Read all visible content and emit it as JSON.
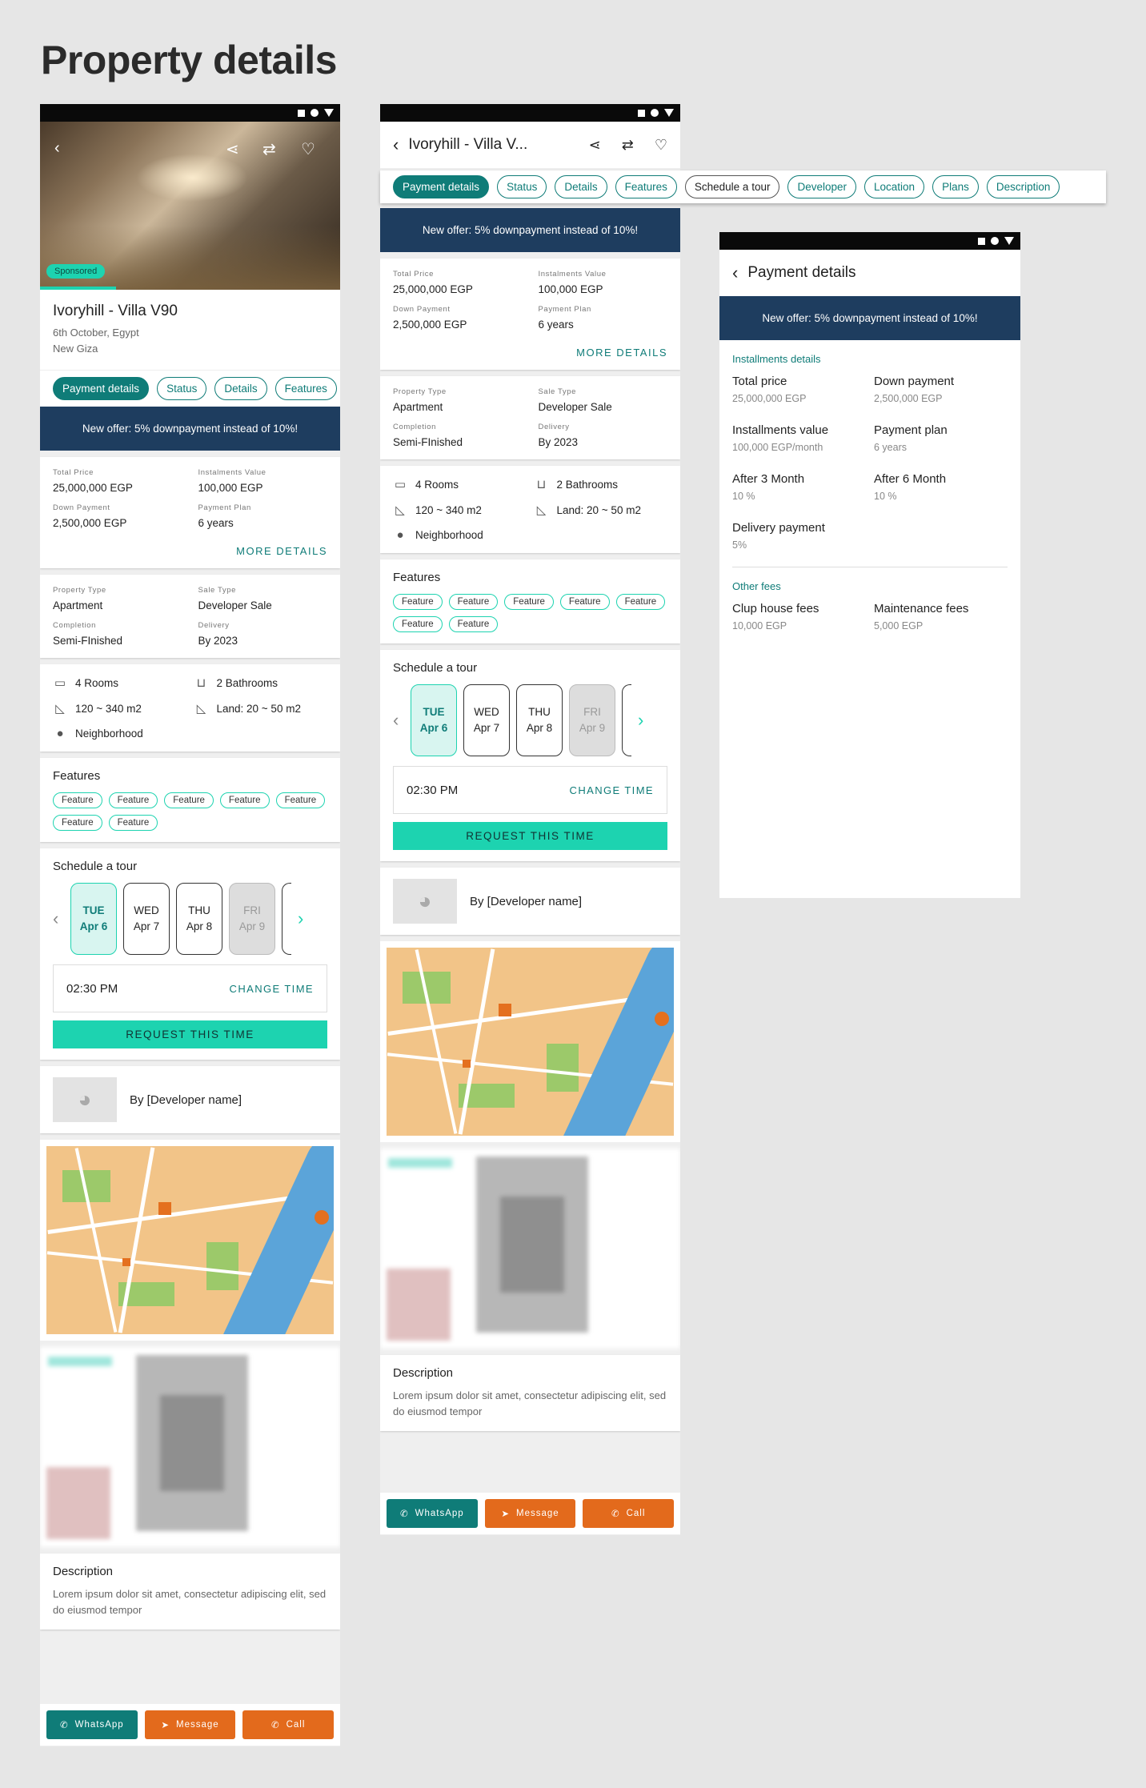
{
  "page_title": "Property details",
  "property": {
    "name": "Ivoryhill - Villa V90",
    "name_short": "Ivoryhill - Villa V...",
    "city": "6th October, Egypt",
    "area": "New Giza",
    "sponsored": "Sponsored"
  },
  "tabs": [
    "Payment details",
    "Status",
    "Details",
    "Features",
    "Schedule a tour",
    "Developer",
    "Location",
    "Plans",
    "Description"
  ],
  "offer": "New offer: 5% downpayment instead of 10%!",
  "price": {
    "total_label": "Total Price",
    "total": "25,000,000 EGP",
    "inst_label": "Instalments Value",
    "inst": "100,000 EGP",
    "down_label": "Down Payment",
    "down": "2,500,000 EGP",
    "plan_label": "Payment Plan",
    "plan": "6 years",
    "more": "MORE DETAILS"
  },
  "info": {
    "type_label": "Property Type",
    "type": "Apartment",
    "sale_label": "Sale Type",
    "sale": "Developer Sale",
    "comp_label": "Completion",
    "comp": "Semi-FInished",
    "deliv_label": "Delivery",
    "deliv": "By 2023"
  },
  "amenities": {
    "rooms": "4 Rooms",
    "baths": "2 Bathrooms",
    "area": "120 ~ 340 m2",
    "land": "Land: 20 ~ 50 m2",
    "hood": "Neighborhood"
  },
  "features": {
    "title": "Features",
    "items": [
      "Feature",
      "Feature",
      "Feature",
      "Feature",
      "Feature",
      "Feature",
      "Feature"
    ]
  },
  "tour": {
    "title": "Schedule a tour",
    "days_p1": [
      {
        "d": "TUE",
        "n": "Apr 6"
      },
      {
        "d": "WED",
        "n": "Apr 7"
      },
      {
        "d": "THU",
        "n": "Apr 8"
      },
      {
        "d": "FRI",
        "n": "Apr 9"
      }
    ],
    "days_p2": [
      {
        "d": "TUE",
        "n": "Apr 6"
      },
      {
        "d": "WED",
        "n": "Apr 7"
      },
      {
        "d": "THU",
        "n": "Apr 8"
      },
      {
        "d": "FRI",
        "n": "Apr 9"
      }
    ],
    "time": "02:30 PM",
    "change": "CHANGE TIME",
    "request": "REQUEST THIS TIME"
  },
  "developer": {
    "name": "By [Developer name]"
  },
  "description": {
    "title": "Description",
    "body": "Lorem ipsum dolor sit amet, consectetur adipiscing elit, sed do eiusmod tempor"
  },
  "bottom": {
    "whatsapp": "WhatsApp",
    "message": "Message",
    "call": "Call"
  },
  "payment_page": {
    "title": "Payment details",
    "inst_head": "Installments details",
    "items": [
      {
        "l": "Total price",
        "v": "25,000,000 EGP"
      },
      {
        "l": "Down payment",
        "v": "2,500,000 EGP"
      },
      {
        "l": "Installments value",
        "v": "100,000 EGP/month"
      },
      {
        "l": "Payment plan",
        "v": "6 years"
      },
      {
        "l": "After 3 Month",
        "v": "10 %"
      },
      {
        "l": "After 6 Month",
        "v": "10 %"
      },
      {
        "l": "Delivery payment",
        "v": "5%"
      }
    ],
    "fees_head": "Other fees",
    "fees": [
      {
        "l": "Clup house fees",
        "v": "10,000 EGP"
      },
      {
        "l": "Maintenance fees",
        "v": "5,000 EGP"
      }
    ]
  },
  "colors": {
    "teal": "#0f7c78",
    "aqua": "#1dd3b0",
    "navy": "#1e3d5f",
    "orange": "#e36a1c"
  }
}
